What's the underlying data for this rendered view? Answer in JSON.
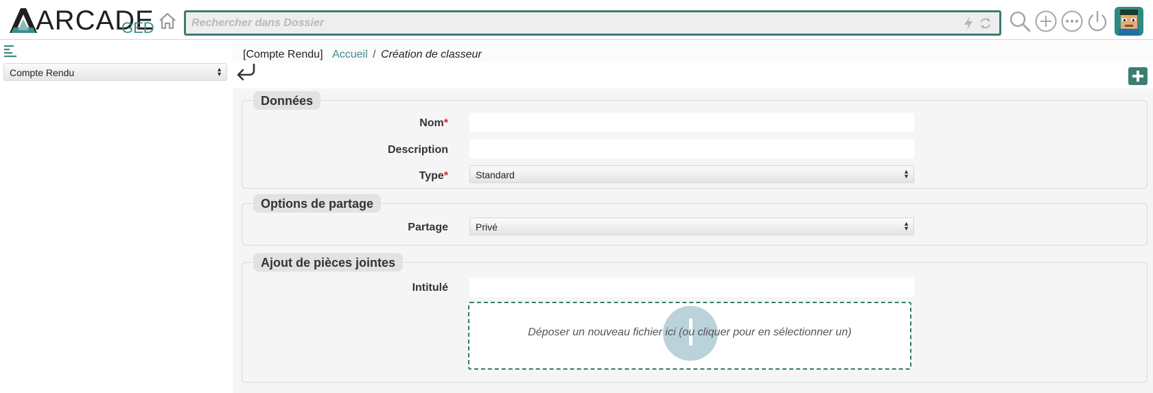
{
  "app": {
    "logo_text": "ARCADE",
    "logo_sub": "GED"
  },
  "topbar": {
    "search_placeholder": "Rechercher dans Dossier",
    "icons": [
      "home-icon",
      "bolt-icon",
      "sync-icon",
      "search-icon",
      "add-circle-icon",
      "more-icon",
      "power-icon"
    ]
  },
  "sidebar": {
    "selected_context": "Compte Rendu"
  },
  "breadcrumb": {
    "context": "[Compte Rendu]",
    "home": "Accueil",
    "separator": "/",
    "current": "Création de classeur"
  },
  "form": {
    "sections": {
      "data": {
        "title": "Données",
        "name_label": "Nom",
        "name_value": "",
        "description_label": "Description",
        "description_value": "",
        "type_label": "Type",
        "type_value": "Standard",
        "required_mark": "*"
      },
      "sharing": {
        "title": "Options de partage",
        "share_label": "Partage",
        "share_value": "Privé"
      },
      "attachments": {
        "title": "Ajout de pièces jointes",
        "title_label": "Intitulé",
        "title_value": "",
        "dropzone_text": "Déposer un nouveau fichier ici (ou cliquer pour en sélectionner un)"
      }
    }
  },
  "colors": {
    "accent": "#3a8a86",
    "search_border": "#3d7a74",
    "add_button": "#3b7f70",
    "required": "#d9262b"
  }
}
